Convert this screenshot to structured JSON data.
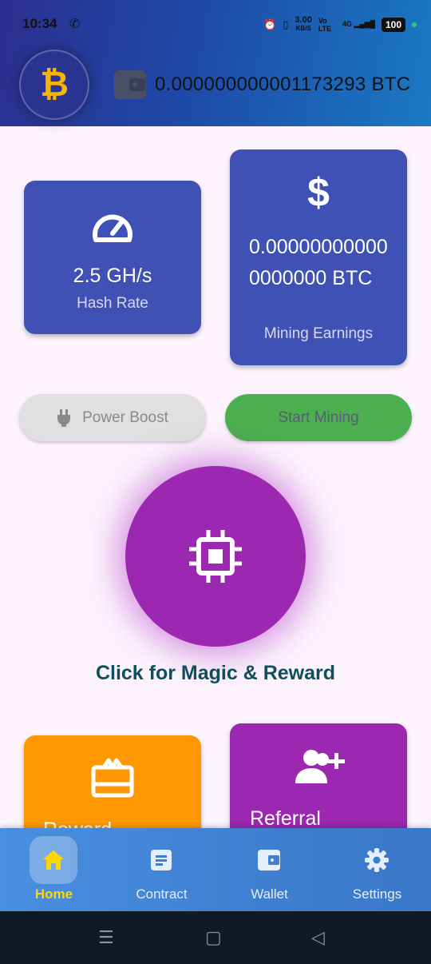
{
  "status": {
    "time": "10:34",
    "net_speed": "3.00",
    "net_unit": "KB/S",
    "volte": "Vo LTE",
    "signal": "4G",
    "battery": "100"
  },
  "header": {
    "coin_symbol": "₿",
    "balance": "0.000000000001173293 BTC"
  },
  "stats": {
    "hash_rate_value": "2.5 GH/s",
    "hash_rate_label": "Hash Rate",
    "earnings_symbol": "$",
    "earnings_value": "0.000000000000000000 BTC",
    "earnings_label": "Mining Earnings"
  },
  "buttons": {
    "power_boost": "Power Boost",
    "start_mining": "Start Mining"
  },
  "magic": {
    "label": "Click for Magic & Reward"
  },
  "bottom_cards": {
    "reward_label": "Reward",
    "referral_label": "Referral"
  },
  "nav": {
    "items": [
      {
        "label": "Home",
        "icon": "home-icon",
        "active": true
      },
      {
        "label": "Contract",
        "icon": "contract-icon",
        "active": false
      },
      {
        "label": "Wallet",
        "icon": "wallet-icon",
        "active": false
      },
      {
        "label": "Settings",
        "icon": "gear-icon",
        "active": false
      }
    ]
  },
  "colors": {
    "primary_card": "#3f51b5",
    "magic": "#9c27b0",
    "reward": "#ff9800",
    "start_mining": "#4caf50",
    "nav_active": "#ffd600"
  }
}
